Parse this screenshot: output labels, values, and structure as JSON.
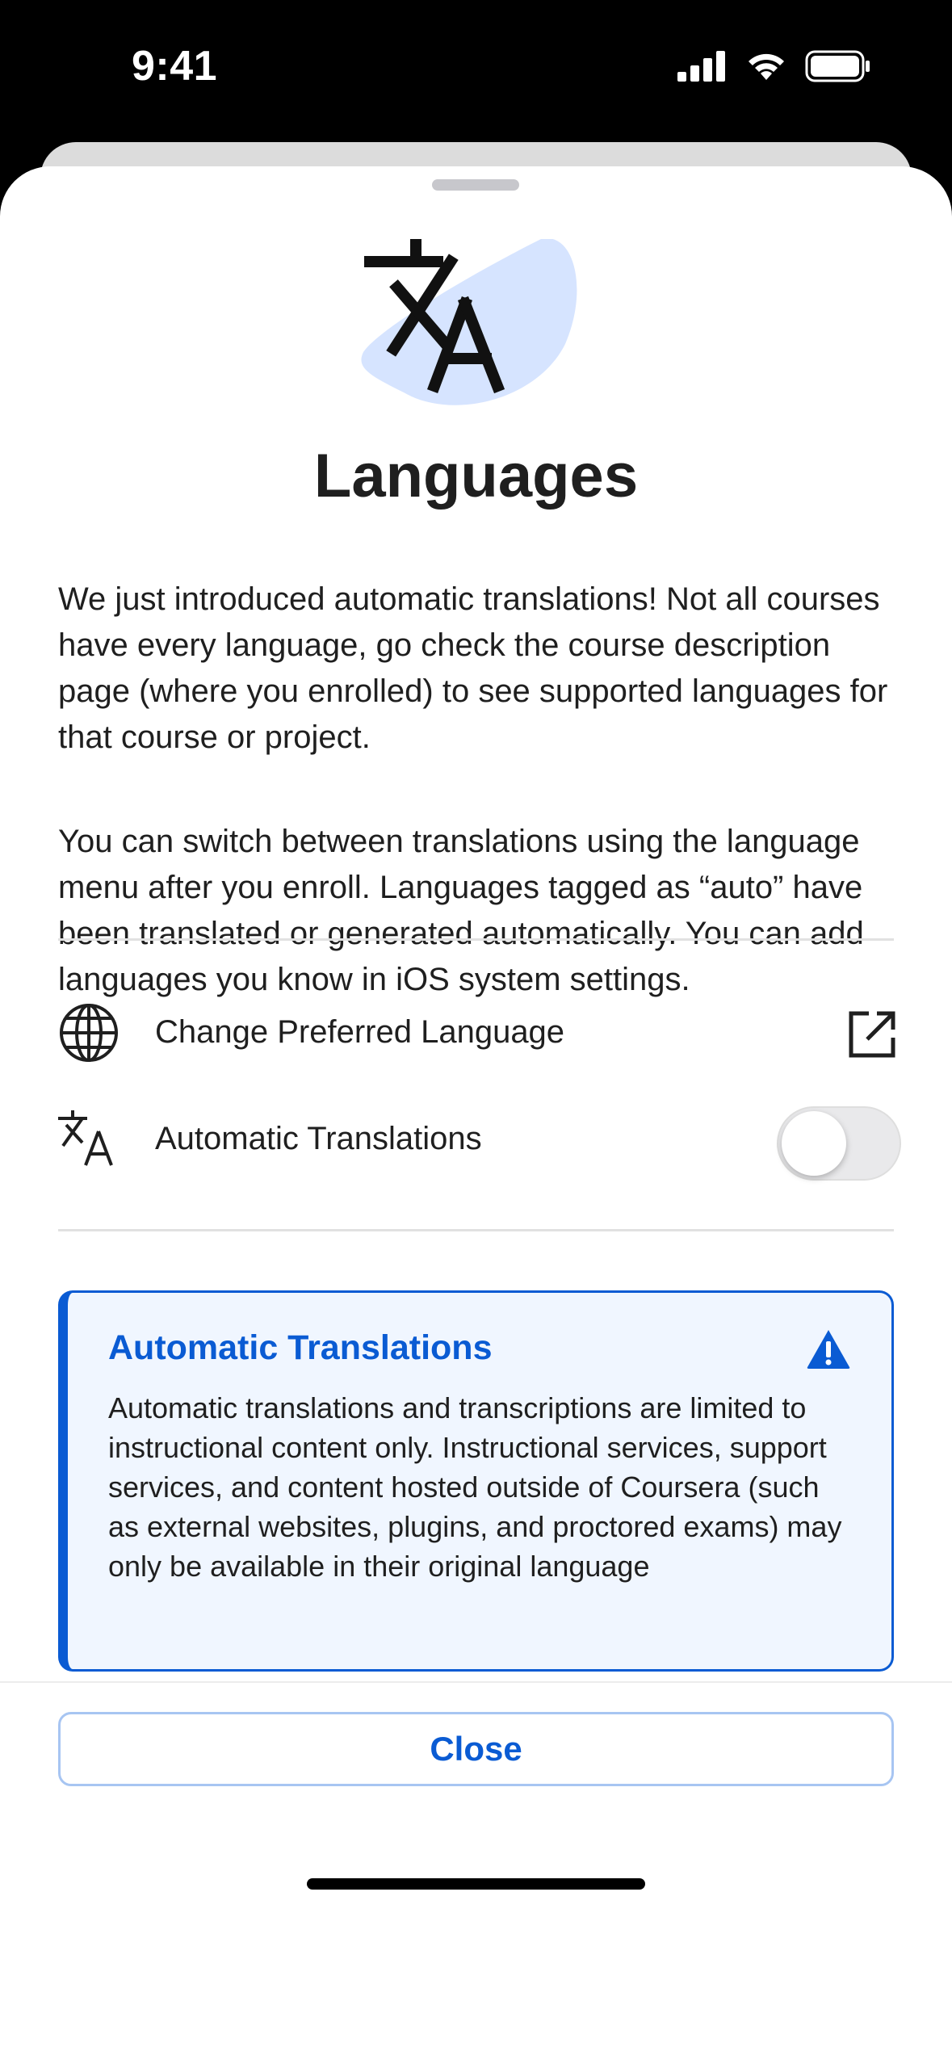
{
  "status_bar": {
    "time": "9:41",
    "icons": [
      "cellular-signal-icon",
      "wifi-icon",
      "battery-icon"
    ]
  },
  "header": {
    "hero_icon": "translate-icon",
    "title": "Languages"
  },
  "intro": {
    "paragraph_1": "We just introduced automatic translations! Not all courses have every language, go check the course description page (where you enrolled) to see supported languages for that course or project.",
    "paragraph_2": "You can switch between translations using the language menu after you enroll. Languages tagged as “auto” have been translated or generated automatically. You can add languages you know in iOS system settings."
  },
  "settings": {
    "preferred_language": {
      "label": "Change Preferred Language",
      "icon": "globe-icon",
      "action_icon": "external-link-icon"
    },
    "automatic_translations": {
      "label": "Automatic Translations",
      "icon": "translate-icon",
      "enabled": false
    }
  },
  "notice": {
    "title": "Automatic Translations",
    "icon": "warning-icon",
    "body": "Automatic translations and transcriptions are limited to instructional content only. Instructional services, support services, and content hosted outside of Coursera (such as external websites, plugins, and proctored exams) may only be available in their original language"
  },
  "footer": {
    "close_label": "Close"
  },
  "colors": {
    "accent": "#0a5bd3",
    "notice_bg": "#f0f6ff",
    "hero_blob": "#d6e4ff",
    "text": "#1f1f1f"
  }
}
